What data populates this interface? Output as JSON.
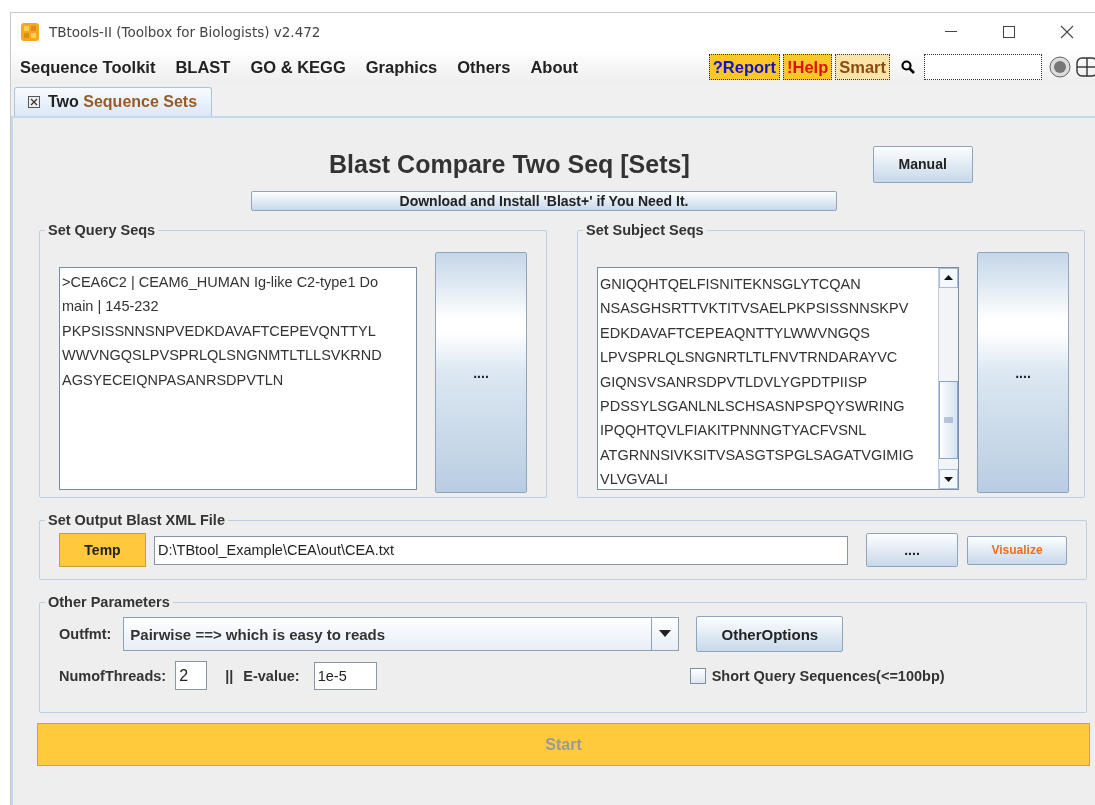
{
  "window": {
    "title": "TBtools-II (Toolbox for Biologists) v2.472"
  },
  "menu": [
    "Sequence Toolkit",
    "BLAST",
    "GO & KEGG",
    "Graphics",
    "Others",
    "About"
  ],
  "toolbar_buttons": [
    {
      "label": "?Report",
      "kind": "info"
    },
    {
      "label": "!Help",
      "kind": "alert"
    },
    {
      "label": "Smart",
      "kind": "plain"
    }
  ],
  "tabs": [
    {
      "prefix": "Two",
      "label": "Sequence Sets",
      "selected": true
    }
  ],
  "heading": "Blast Compare Two Seq [Sets]",
  "manual_button": "Manual",
  "download_button": "Download and Install 'Blast+' if You Need It.",
  "query": {
    "title": "Set Query Seqs",
    "lines": [
      ">CEA6C2 | CEAM6_HUMAN Ig-like C2-type1 Do",
      "main | 145-232",
      "PKPSISSNNSNPVEDKDAVAFTCEPEVQNTTYL",
      "WWVNGQSLPVSPRLQLSNGNMTLTLLSVKRND",
      "AGSYECEIQNPASANRSDPVTLN"
    ],
    "button": "...."
  },
  "subject": {
    "title": "Set Subject Seqs",
    "lines": [
      "GNIQQHTQELFISNITEKNSGLYTCQAN",
      "NSASGHSRTTVKTITVSAELPKPSISSNNSKPV",
      "EDKDAVAFTCEPEAQNTTYLWWVNGQS",
      "LPVSPRLQLSNGNRTLTLFNVTRNDARAYVC",
      "GIQNSVSANRSDPVTLDVLYGPDTPIISP",
      "PDSSYLSGANLNLSCHSASNPSPQYSWRING",
      "IPQQHTQVLFIAKITPNNNGTYACFVSNL",
      "ATGRNNSIVKSITVSASGTSPGLSAGATVGIMIG",
      "VLVGVALI"
    ],
    "button": "...."
  },
  "output": {
    "title": "Set Output Blast XML File",
    "temp_button": "Temp",
    "path": "D:\\TBtool_Example\\CEA\\out\\CEA.txt",
    "browse_button": "....",
    "visualize_button": "Visualize"
  },
  "parameters": {
    "title": "Other Parameters",
    "outfmt_label": "Outfmt:",
    "outfmt_value": "Pairwise ==> which is easy to reads",
    "other_options_button": "OtherOptions",
    "threads_label": "NumofThreads:",
    "threads_value": "2",
    "separator": "||",
    "evalue_label": "E-value:",
    "evalue_value": "1e-5",
    "short_query": {
      "label": "Short Query Sequences(<=100bp)",
      "checked": false
    }
  },
  "start_button": {
    "label": "Start",
    "disabled": true
  }
}
